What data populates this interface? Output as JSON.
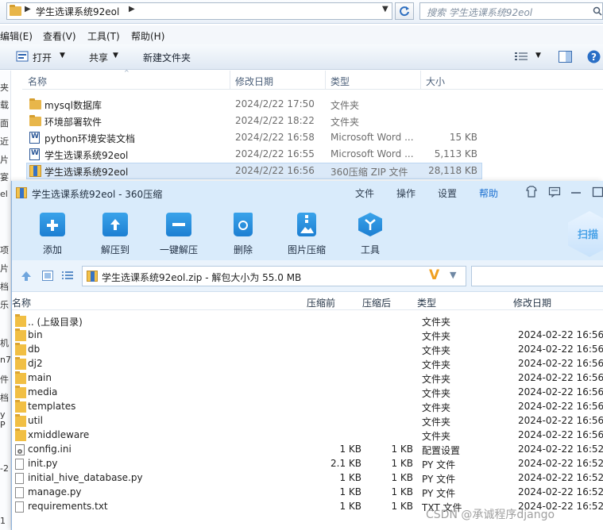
{
  "explorer": {
    "address": {
      "path": "学生选课系统92eol",
      "search_placeholder": "搜索 学生选课系统92eol"
    },
    "menu": [
      "编辑(E)",
      "查看(V)",
      "工具(T)",
      "帮助(H)"
    ],
    "toolbar": {
      "open": "打开",
      "share": "共享",
      "new_folder": "新建文件夹"
    },
    "left_nav_chars": [
      "夹",
      "载",
      "面",
      "近",
      "片",
      "宴",
      "el",
      "",
      "",
      "项",
      "片",
      "档",
      "乐",
      "",
      "机",
      "n7",
      "件",
      "档",
      "y P",
      "",
      "",
      "-2",
      "1"
    ],
    "columns": [
      "名称",
      "修改日期",
      "类型",
      "大小"
    ],
    "files": [
      {
        "name": "mysql数据库",
        "date": "2024/2/22 17:50",
        "type": "文件夹",
        "size": "",
        "icon": "folder-icon"
      },
      {
        "name": "环境部署软件",
        "date": "2024/2/22 18:22",
        "type": "文件夹",
        "size": "",
        "icon": "folder-icon"
      },
      {
        "name": "python环境安装文档",
        "date": "2024/2/22 16:58",
        "type": "Microsoft Word ...",
        "size": "15 KB",
        "icon": "word-doc-icon"
      },
      {
        "name": "学生选课系统92eol",
        "date": "2024/2/22 16:55",
        "type": "Microsoft Word ...",
        "size": "5,113 KB",
        "icon": "word-doc-icon"
      },
      {
        "name": "学生选课系统92eol",
        "date": "2024/2/22 16:56",
        "type": "360压缩 ZIP 文件",
        "size": "28,118 KB",
        "icon": "zip-archive-icon"
      }
    ]
  },
  "zip": {
    "title": "学生选课系统92eol - 360压缩",
    "menu": [
      "文件",
      "操作",
      "设置",
      "帮助"
    ],
    "ribbon": [
      "添加",
      "解压到",
      "一键解压",
      "删除",
      "图片压缩",
      "工具"
    ],
    "scan_label": "扫描",
    "path": "学生选课系统92eol.zip - 解包大小为 55.0 MB",
    "columns": [
      "名称",
      "压缩前",
      "压缩后",
      "类型",
      "修改日期"
    ],
    "entries": [
      {
        "name": ".. (上级目录)",
        "before": "",
        "after": "",
        "type": "文件夹",
        "date": "",
        "icon": "folder-icon"
      },
      {
        "name": "bin",
        "before": "",
        "after": "",
        "type": "文件夹",
        "date": "2024-02-22 16:56",
        "icon": "folder-icon"
      },
      {
        "name": "db",
        "before": "",
        "after": "",
        "type": "文件夹",
        "date": "2024-02-22 16:56",
        "icon": "folder-icon"
      },
      {
        "name": "dj2",
        "before": "",
        "after": "",
        "type": "文件夹",
        "date": "2024-02-22 16:56",
        "icon": "folder-icon"
      },
      {
        "name": "main",
        "before": "",
        "after": "",
        "type": "文件夹",
        "date": "2024-02-22 16:56",
        "icon": "folder-icon"
      },
      {
        "name": "media",
        "before": "",
        "after": "",
        "type": "文件夹",
        "date": "2024-02-22 16:56",
        "icon": "folder-icon"
      },
      {
        "name": "templates",
        "before": "",
        "after": "",
        "type": "文件夹",
        "date": "2024-02-22 16:56",
        "icon": "folder-icon"
      },
      {
        "name": "util",
        "before": "",
        "after": "",
        "type": "文件夹",
        "date": "2024-02-22 16:56",
        "icon": "folder-icon"
      },
      {
        "name": "xmiddleware",
        "before": "",
        "after": "",
        "type": "文件夹",
        "date": "2024-02-22 16:56",
        "icon": "folder-icon"
      },
      {
        "name": "config.ini",
        "before": "1 KB",
        "after": "1 KB",
        "type": "配置设置",
        "date": "2024-02-22 16:52",
        "icon": "config-file-icon"
      },
      {
        "name": "init.py",
        "before": "2.1 KB",
        "after": "1 KB",
        "type": "PY 文件",
        "date": "2024-02-22 16:52",
        "icon": "file-icon"
      },
      {
        "name": "initial_hive_database.py",
        "before": "1 KB",
        "after": "1 KB",
        "type": "PY 文件",
        "date": "2024-02-22 16:52",
        "icon": "file-icon"
      },
      {
        "name": "manage.py",
        "before": "1 KB",
        "after": "1 KB",
        "type": "PY 文件",
        "date": "2024-02-22 16:52",
        "icon": "file-icon"
      },
      {
        "name": "requirements.txt",
        "before": "1 KB",
        "after": "1 KB",
        "type": "TXT 文件",
        "date": "2024-02-22 16:52",
        "icon": "file-icon"
      }
    ]
  },
  "watermark": "CSDN @承诚程序django",
  "colors": {
    "accent": "#1a6fd0",
    "ribbon_bg": "#d9ebfb",
    "selection": "#dbe9f8"
  }
}
